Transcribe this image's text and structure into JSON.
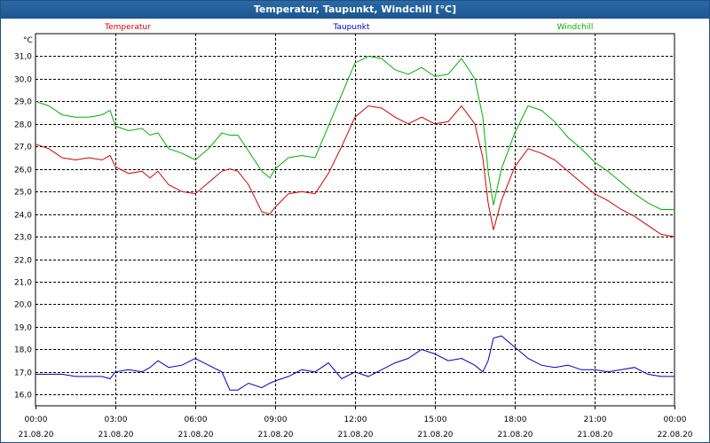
{
  "window": {
    "title": "Temperatur, Taupunkt, Windchill [°C]"
  },
  "chart_data": {
    "type": "line",
    "title": "Temperatur, Taupunkt, Windchill [°C]",
    "ylabel": "°C",
    "ylim": [
      15.5,
      32.0
    ],
    "yticks": [
      "16,0",
      "17,0",
      "18,0",
      "19,0",
      "20,0",
      "21,0",
      "22,0",
      "23,0",
      "24,0",
      "25,0",
      "26,0",
      "27,0",
      "28,0",
      "29,0",
      "30,0",
      "31,0"
    ],
    "xlim": [
      0,
      24
    ],
    "xticks": [
      {
        "time": "00:00",
        "date": "21.08.20"
      },
      {
        "time": "03:00",
        "date": "21.08.20"
      },
      {
        "time": "06:00",
        "date": "21.08.20"
      },
      {
        "time": "09:00",
        "date": "21.08.20"
      },
      {
        "time": "12:00",
        "date": "21.08.20"
      },
      {
        "time": "15:00",
        "date": "21.08.20"
      },
      {
        "time": "18:00",
        "date": "21.08.20"
      },
      {
        "time": "21:00",
        "date": "21.08.20"
      },
      {
        "time": "00:00",
        "date": "22.08.20"
      }
    ],
    "grid": true,
    "legend_position": "top",
    "x": [
      0,
      0.5,
      1,
      1.5,
      2,
      2.5,
      2.8,
      3,
      3.5,
      4,
      4.3,
      4.6,
      5,
      5.5,
      6,
      6.5,
      7,
      7.3,
      7.6,
      8,
      8.5,
      8.8,
      9,
      9.5,
      10,
      10.5,
      11,
      11.5,
      12,
      12.5,
      13,
      13.5,
      14,
      14.5,
      15,
      15.5,
      16,
      16.5,
      16.8,
      17,
      17.2,
      17.5,
      18,
      18.5,
      19,
      19.5,
      20,
      20.5,
      21,
      21.5,
      22,
      22.5,
      23,
      23.5,
      24
    ],
    "series": [
      {
        "name": "Temperatur",
        "color": "#d00000",
        "values": [
          27.1,
          26.9,
          26.5,
          26.4,
          26.5,
          26.4,
          26.6,
          26.1,
          25.8,
          25.9,
          25.6,
          25.9,
          25.3,
          25.0,
          24.9,
          25.4,
          25.9,
          26.0,
          25.9,
          25.3,
          24.1,
          24.0,
          24.3,
          24.9,
          25.0,
          24.9,
          25.8,
          27.0,
          28.3,
          28.8,
          28.7,
          28.3,
          28.0,
          28.3,
          28.0,
          28.1,
          28.8,
          28.0,
          26.5,
          24.5,
          23.3,
          24.6,
          26.1,
          26.9,
          26.7,
          26.4,
          25.9,
          25.4,
          24.9,
          24.6,
          24.2,
          23.9,
          23.5,
          23.1,
          23.0
        ]
      },
      {
        "name": "Taupunkt",
        "color": "#0000c0",
        "values": [
          16.9,
          16.9,
          16.9,
          16.8,
          16.8,
          16.8,
          16.7,
          17.0,
          17.1,
          17.0,
          17.2,
          17.5,
          17.2,
          17.3,
          17.6,
          17.3,
          17.0,
          16.2,
          16.2,
          16.5,
          16.3,
          16.5,
          16.6,
          16.8,
          17.1,
          17.0,
          17.4,
          16.7,
          17.0,
          16.8,
          17.1,
          17.4,
          17.6,
          18.0,
          17.8,
          17.5,
          17.6,
          17.3,
          17.0,
          17.5,
          18.5,
          18.6,
          18.1,
          17.6,
          17.3,
          17.2,
          17.3,
          17.1,
          17.1,
          17.0,
          17.1,
          17.2,
          16.9,
          16.8,
          16.8
        ]
      },
      {
        "name": "Windchill",
        "color": "#00b000",
        "values": [
          29.0,
          28.8,
          28.4,
          28.3,
          28.3,
          28.4,
          28.6,
          27.9,
          27.7,
          27.8,
          27.5,
          27.6,
          26.9,
          26.7,
          26.4,
          26.9,
          27.6,
          27.5,
          27.5,
          26.8,
          25.9,
          25.6,
          26.0,
          26.5,
          26.6,
          26.5,
          27.9,
          29.3,
          30.7,
          31.0,
          30.9,
          30.4,
          30.2,
          30.5,
          30.1,
          30.2,
          30.9,
          30.0,
          28.3,
          25.9,
          24.4,
          26.0,
          27.6,
          28.8,
          28.6,
          28.1,
          27.4,
          26.9,
          26.3,
          25.9,
          25.4,
          24.9,
          24.5,
          24.2,
          24.2
        ]
      }
    ]
  }
}
